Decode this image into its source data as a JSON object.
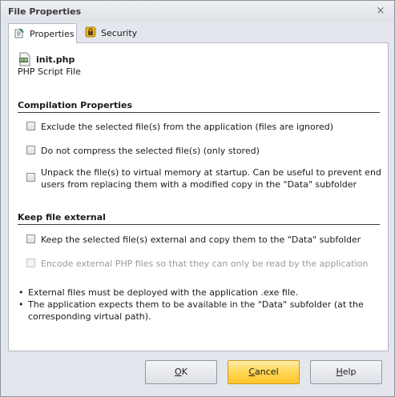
{
  "window": {
    "title": "File Properties",
    "close_symbol": "×"
  },
  "tabs": [
    {
      "label": "Properties",
      "icon": "properties-icon",
      "active": true
    },
    {
      "label": "Security",
      "icon": "lock-icon",
      "active": false
    }
  ],
  "file": {
    "name": "init.php",
    "type": "PHP Script File",
    "icon": "php-file-icon"
  },
  "compilation": {
    "title": "Compilation Properties",
    "options": [
      {
        "label": "Exclude the selected file(s) from the application (files are ignored)",
        "checked": false,
        "enabled": true
      },
      {
        "label": "Do not compress the selected file(s) (only stored)",
        "checked": false,
        "enabled": true
      },
      {
        "label": "Unpack the file(s) to virtual memory at startup. Can be useful to prevent end users from replacing them with a modified copy in the \"Data\" subfolder",
        "checked": false,
        "enabled": true
      }
    ]
  },
  "external": {
    "title": "Keep file external",
    "options": [
      {
        "label": "Keep the selected file(s) external and copy them to the \"Data\" subfolder",
        "checked": false,
        "enabled": true
      },
      {
        "label": "Encode external PHP files so that they can only be read by the application",
        "checked": false,
        "enabled": false
      }
    ]
  },
  "notes": {
    "bullet": "•",
    "items": [
      "External files must be deployed with the application .exe file.",
      "The application expects them to be available in the \"Data\" subfolder (at the corresponding virtual path)."
    ]
  },
  "buttons": {
    "ok": {
      "prefix": "",
      "underline": "O",
      "suffix": "K"
    },
    "cancel": {
      "prefix": "",
      "underline": "C",
      "suffix": "ancel"
    },
    "help": {
      "prefix": "",
      "underline": "H",
      "suffix": "elp"
    }
  },
  "colors": {
    "accent_button": "#ffc42a",
    "window_bg": "#e3e6ec",
    "panel_bg": "#ffffff"
  }
}
